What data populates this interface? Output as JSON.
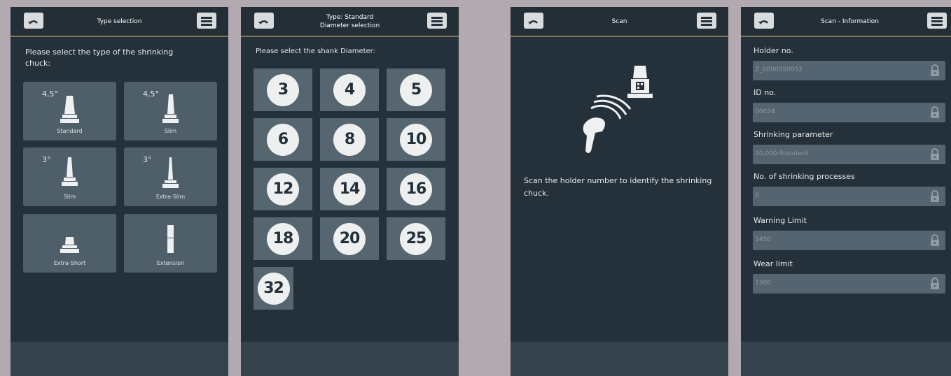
{
  "screens": [
    {
      "title": "Type selection",
      "prompt": "Please select the type of the shrinking chuck:",
      "types": [
        {
          "label": "Standard",
          "angle": "4,5°",
          "icon": "standard-chuck-icon"
        },
        {
          "label": "Slim",
          "angle": "4,5°",
          "icon": "slim-chuck-icon"
        },
        {
          "label": "Slim",
          "angle": "3°",
          "icon": "slim-chuck-3-icon"
        },
        {
          "label": "Extra-Slim",
          "angle": "3°",
          "icon": "extra-slim-chuck-icon"
        },
        {
          "label": "Extra-Short",
          "angle": "",
          "icon": "extra-short-chuck-icon"
        },
        {
          "label": "Extension",
          "angle": "",
          "icon": "extension-chuck-icon"
        }
      ]
    },
    {
      "title_line1": "Type: Standard",
      "title_line2": "Diameter selection",
      "prompt": "Please select the shank Diameter:",
      "diameters": [
        "3",
        "4",
        "5",
        "6",
        "8",
        "10",
        "12",
        "14",
        "16",
        "18",
        "20",
        "25",
        "32"
      ]
    },
    {
      "title": "Scan",
      "instruction": "Scan the holder number to identify the shrinking chuck.",
      "icon": "barcode-scanner-icon"
    },
    {
      "title": "Scan - Information",
      "fields": [
        {
          "label": "Holder no.",
          "value": "Z_0000050052"
        },
        {
          "label": "ID no.",
          "value": "00034"
        },
        {
          "label": "Shrinking parameter",
          "value": "10,000-Standard"
        },
        {
          "label": "No. of shrinking processes",
          "value": "0"
        },
        {
          "label": "Warning Limit",
          "value": "1450"
        },
        {
          "label": "Wear limit",
          "value": "1500"
        }
      ]
    }
  ],
  "colors": {
    "background": "#b3aab1",
    "screen": "#25313a",
    "header_accent": "#82765a",
    "tile": "#4f5f69",
    "footer": "#35434c"
  }
}
